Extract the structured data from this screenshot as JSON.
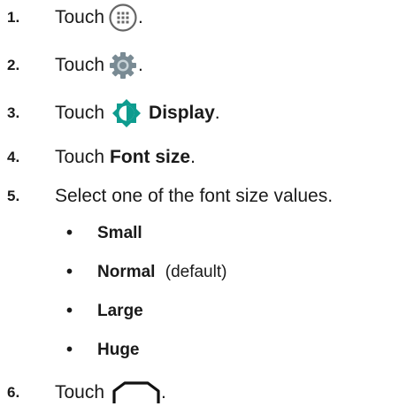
{
  "steps": [
    {
      "num": "1.",
      "before": "Touch",
      "after": "."
    },
    {
      "num": "2.",
      "before": "Touch",
      "after": "."
    },
    {
      "num": "3.",
      "before": "Touch",
      "bold": "Display",
      "after": "."
    },
    {
      "num": "4.",
      "before": "Touch",
      "bold": "Font size",
      "after": "."
    },
    {
      "num": "5.",
      "text": "Select one of the font size values."
    },
    {
      "num": "6.",
      "before": "Touch",
      "after": "."
    }
  ],
  "options": [
    {
      "label": "Small",
      "note": ""
    },
    {
      "label": "Normal",
      "note": "(default)"
    },
    {
      "label": "Large",
      "note": ""
    },
    {
      "label": "Huge",
      "note": ""
    }
  ],
  "bullet_char": "•",
  "icons": {
    "step1": "all-apps-icon",
    "step2": "settings-gear-icon",
    "step3": "display-brightness-icon",
    "step6": "home-icon"
  },
  "colors": {
    "text": "#1a1a1a",
    "display_icon": "#0e9c8f",
    "gear_icon": "#7a8b94",
    "apps_icon": "#666666"
  }
}
